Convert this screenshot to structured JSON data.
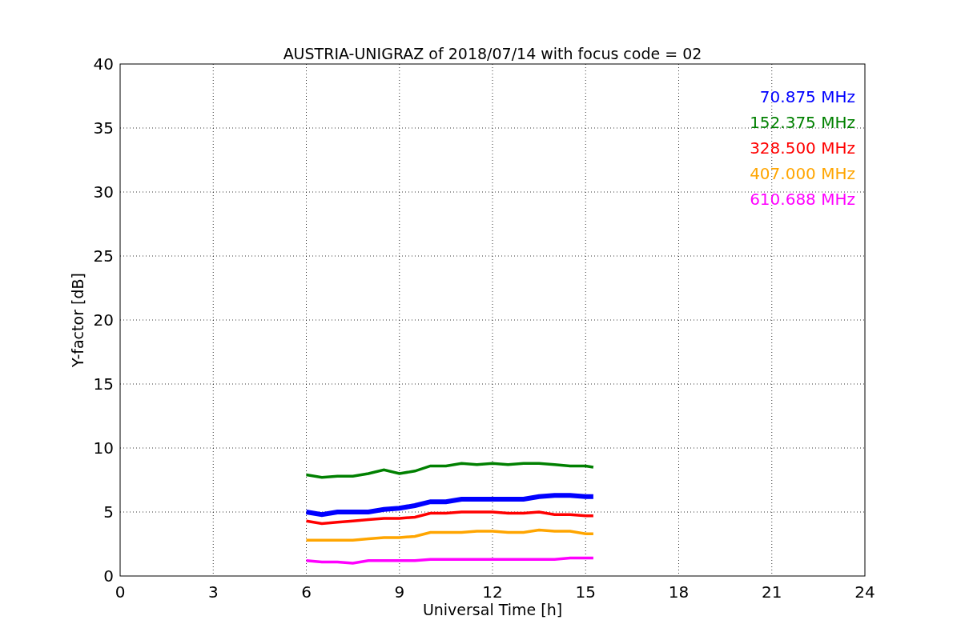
{
  "chart_data": {
    "type": "line",
    "title": "AUSTRIA-UNIGRAZ of 2018/07/14 with focus code = 02",
    "xlabel": "Universal Time [h]",
    "ylabel": "Y-factor [dB]",
    "x": [
      6,
      6.5,
      7,
      7.5,
      8,
      8.5,
      9,
      9.5,
      10,
      10.5,
      11,
      11.5,
      12,
      12.5,
      13,
      13.5,
      14,
      14.5,
      15,
      15.25
    ],
    "series": [
      {
        "name": "70.875 MHz",
        "color": "#0000ff",
        "values": [
          5,
          4.8,
          5,
          5,
          5,
          5.2,
          5.3,
          5.5,
          5.8,
          5.8,
          6,
          6,
          6,
          6,
          6,
          6.2,
          6.3,
          6.3,
          6.2,
          6.2
        ]
      },
      {
        "name": "152.375 MHz",
        "color": "#008000",
        "values": [
          7.9,
          7.7,
          7.8,
          7.8,
          8.0,
          8.3,
          8.0,
          8.2,
          8.6,
          8.6,
          8.8,
          8.7,
          8.8,
          8.7,
          8.8,
          8.8,
          8.7,
          8.6,
          8.6,
          8.5
        ]
      },
      {
        "name": "328.500 MHz",
        "color": "#ff0000",
        "values": [
          4.3,
          4.1,
          4.2,
          4.3,
          4.4,
          4.5,
          4.5,
          4.6,
          4.9,
          4.9,
          5.0,
          5.0,
          5.0,
          4.9,
          4.9,
          5.0,
          4.8,
          4.8,
          4.7,
          4.7
        ]
      },
      {
        "name": "407.000 MHz",
        "color": "#ffa500",
        "values": [
          2.8,
          2.8,
          2.8,
          2.8,
          2.9,
          3.0,
          3.0,
          3.1,
          3.4,
          3.4,
          3.4,
          3.5,
          3.5,
          3.4,
          3.4,
          3.6,
          3.5,
          3.5,
          3.3,
          3.3
        ]
      },
      {
        "name": "610.688 MHz",
        "color": "#ff00ff",
        "values": [
          1.2,
          1.1,
          1.1,
          1.0,
          1.2,
          1.2,
          1.2,
          1.2,
          1.3,
          1.3,
          1.3,
          1.3,
          1.3,
          1.3,
          1.3,
          1.3,
          1.3,
          1.4,
          1.4,
          1.4
        ]
      }
    ],
    "grid": true,
    "xlim": [
      0,
      24
    ],
    "ylim": [
      0,
      40
    ],
    "xticks": [
      0,
      3,
      6,
      9,
      12,
      15,
      18,
      21,
      24
    ],
    "yticks": [
      0,
      5,
      10,
      15,
      20,
      25,
      30,
      35,
      40
    ]
  }
}
